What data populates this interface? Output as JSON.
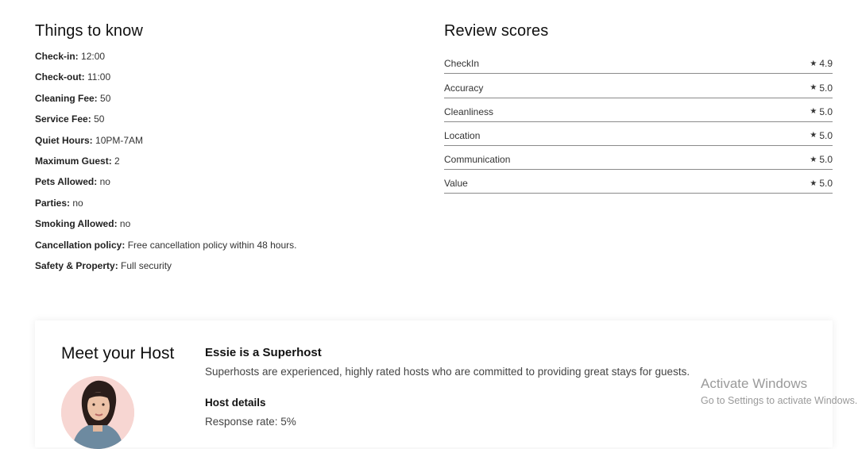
{
  "things": {
    "title": "Things to know",
    "items": [
      {
        "label": "Check-in:",
        "value": "12:00"
      },
      {
        "label": "Check-out:",
        "value": "11:00"
      },
      {
        "label": "Cleaning Fee:",
        "value": "50"
      },
      {
        "label": "Service Fee:",
        "value": "50"
      },
      {
        "label": "Quiet Hours:",
        "value": "10PM-7AM"
      },
      {
        "label": "Maximum Guest:",
        "value": "2"
      },
      {
        "label": "Pets Allowed:",
        "value": "no"
      },
      {
        "label": "Parties:",
        "value": "no"
      },
      {
        "label": "Smoking Allowed:",
        "value": "no"
      },
      {
        "label": "Cancellation policy:",
        "value": "Free cancellation policy within 48 hours."
      },
      {
        "label": "Safety & Property:",
        "value": "Full security"
      }
    ]
  },
  "reviews": {
    "title": "Review scores",
    "star_glyph": "★",
    "items": [
      {
        "label": "CheckIn",
        "score": "4.9"
      },
      {
        "label": "Accuracy",
        "score": "5.0"
      },
      {
        "label": "Cleanliness",
        "score": "5.0"
      },
      {
        "label": "Location",
        "score": "5.0"
      },
      {
        "label": "Communication",
        "score": "5.0"
      },
      {
        "label": "Value",
        "score": "5.0"
      }
    ]
  },
  "host": {
    "title": "Meet your Host",
    "superhost_title": "Essie is a Superhost",
    "superhost_desc": "Superhosts are experienced, highly rated hosts who are committed to providing great stays for guests.",
    "details_title": "Host details",
    "response_rate": "Response rate: 5%"
  },
  "watermark": {
    "title": "Activate Windows",
    "subtitle": "Go to Settings to activate Windows."
  }
}
